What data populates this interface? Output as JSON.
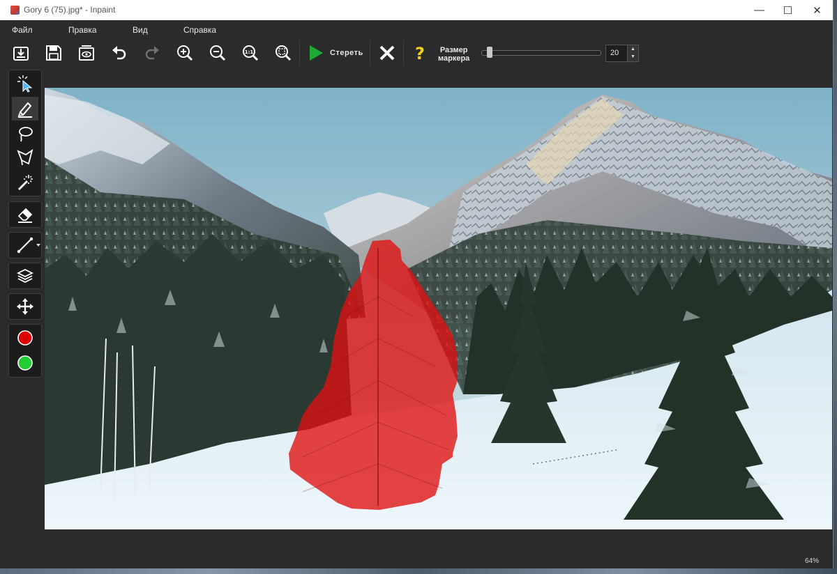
{
  "window": {
    "title": "Gory 6 (75).jpg* - Inpaint",
    "minimize_glyph": "—",
    "maximize_glyph": "☐",
    "close_glyph": "✕"
  },
  "menu": {
    "file": "Файл",
    "edit": "Правка",
    "view": "Вид",
    "help": "Справка"
  },
  "toolbar": {
    "erase_label": "Стереть",
    "marker_size_label_1": "Размер",
    "marker_size_label_2": "маркера",
    "marker_size_value": "20",
    "marker_size_slider_fraction": 0.05,
    "icons": [
      "open-icon",
      "save-icon",
      "save-as-icon",
      "undo-icon",
      "redo-icon",
      "zoom-in-icon",
      "zoom-out-icon",
      "zoom-actual-icon",
      "zoom-fit-icon",
      "play-icon",
      "close-x-icon",
      "help-icon"
    ]
  },
  "tools": [
    "selection-icon",
    "marker-icon",
    "lasso-icon",
    "polygon-lasso-icon",
    "magic-wand-icon",
    "eraser-icon",
    "line-icon",
    "layers-icon",
    "move-icon",
    "red-marker-icon",
    "green-marker-icon"
  ],
  "colors": {
    "accent_green": "#1fa935",
    "marker_red": "#dd0000",
    "marker_green": "#22cc33",
    "help_yellow": "#f1d21b",
    "mask_red": "#e01010"
  },
  "status": {
    "zoom": "64%"
  }
}
